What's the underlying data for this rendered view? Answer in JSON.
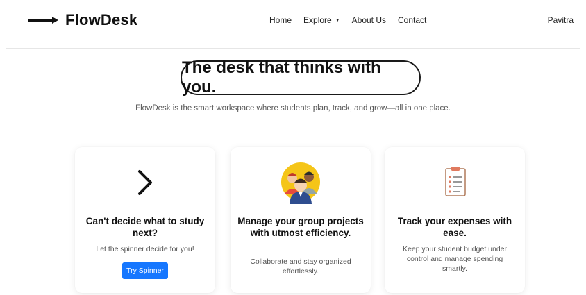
{
  "brand": {
    "name": "FlowDesk"
  },
  "nav": {
    "items": [
      "Home",
      "Explore",
      "About Us",
      "Contact"
    ],
    "explore_caret": "▼",
    "user": "Pavitra"
  },
  "hero": {
    "title": "The desk that thinks with you.",
    "subtitle": "FlowDesk is the smart workspace where students plan, track, and grow—all in one place."
  },
  "cards": [
    {
      "icon": "chevron-right-icon",
      "title": "Can't decide what to study next?",
      "description": "Let the spinner decide for you!",
      "button": "Try Spinner"
    },
    {
      "icon": "group-people-icon",
      "title": "Manage your group projects with utmost efficiency.",
      "description": "Collaborate and stay organized effortlessly."
    },
    {
      "icon": "clipboard-checklist-icon",
      "title": "Track your expenses with ease.",
      "description": "Keep your student budget under control and manage spending smartly."
    }
  ],
  "colors": {
    "accent": "#1677ff",
    "text": "#111111",
    "muted": "#555555",
    "group_bg": "#f5c518"
  }
}
